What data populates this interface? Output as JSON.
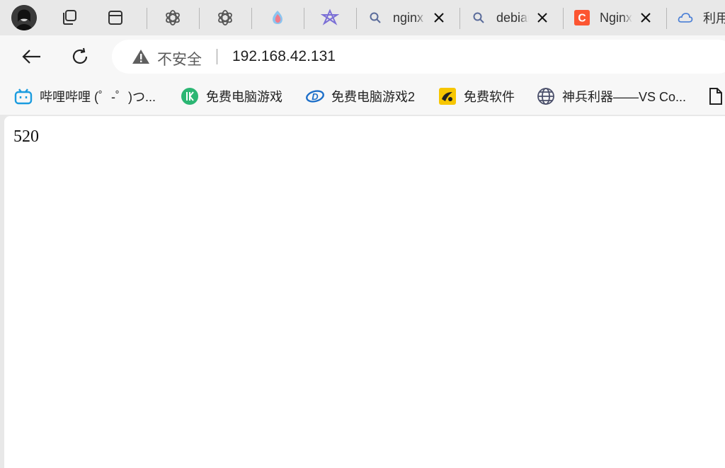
{
  "tab_strip": {
    "pinned": [
      {
        "name": "chatgpt-icon"
      },
      {
        "name": "chatgpt-icon"
      },
      {
        "name": "doubao-icon"
      },
      {
        "name": "kimi-star-icon"
      }
    ],
    "tabs": [
      {
        "title": "nginx",
        "favicon": "search-icon",
        "close": "close-icon"
      },
      {
        "title": "debian",
        "favicon": "search-icon",
        "close": "close-icon"
      },
      {
        "title": "Nginx",
        "favicon": "csdn-icon",
        "close": "close-icon"
      },
      {
        "title": "利用",
        "favicon": "cloud-icon"
      }
    ]
  },
  "toolbar": {
    "security_label": "不安全",
    "url": "192.168.42.131"
  },
  "bookmarks": [
    {
      "label": "哔哩哔哩 (゜-゜)つ...",
      "icon": "bilibili-icon"
    },
    {
      "label": "免费电脑游戏",
      "icon": "game-green-icon"
    },
    {
      "label": "免费电脑游戏2",
      "icon": "game-blue-icon"
    },
    {
      "label": "免费软件",
      "icon": "software-yellow-icon"
    },
    {
      "label": "神兵利器——VS Co...",
      "icon": "globe-icon"
    },
    {
      "label": "",
      "icon": "document-icon"
    }
  ],
  "page": {
    "body_text": "520"
  },
  "colors": {
    "csdn": "#fc5531",
    "bilibili": "#1b9cdf",
    "green_game": "#2bb673",
    "yellow_software": "#f7c600"
  }
}
